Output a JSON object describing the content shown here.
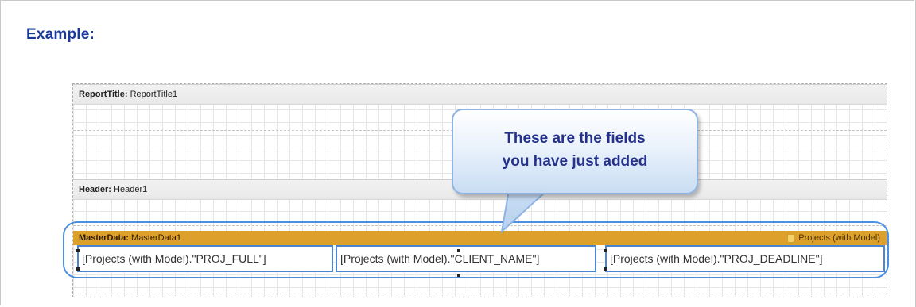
{
  "heading": "Example:",
  "report_title_band": {
    "name_label": "ReportTitle:",
    "name_value": "ReportTitle1"
  },
  "header_band": {
    "name_label": "Header:",
    "name_value": "Header1"
  },
  "master_data_band": {
    "name_label": "MasterData:",
    "name_value": "MasterData1",
    "datasource": "Projects (with Model)",
    "fields": [
      {
        "text": "[Projects (with Model).\"PROJ_FULL\"]"
      },
      {
        "text": "[Projects (with Model).\"CLIENT_NAME\"]"
      },
      {
        "text": "[Projects (with Model).\"PROJ_DEADLINE\"]"
      }
    ]
  },
  "callout": {
    "line1": "These are the fields",
    "line2": "you have just added"
  },
  "colors": {
    "heading": "#1a3a9a",
    "band_header": "#dda02a",
    "field_border": "#4d84d0",
    "callout_text": "#23318a"
  },
  "icons": {
    "datasource": "database-icon"
  }
}
